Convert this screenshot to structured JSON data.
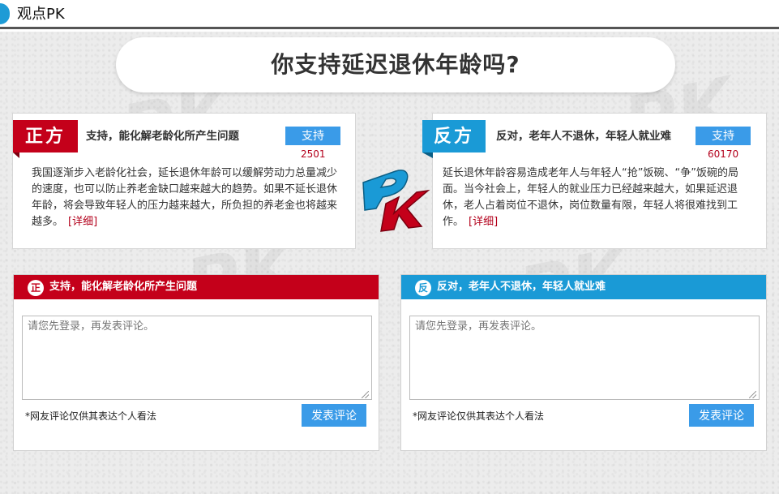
{
  "header": {
    "title": "观点PK"
  },
  "question": "你支持延迟退休年龄吗?",
  "pro": {
    "tag": "正方",
    "title": "支持，能化解老龄化所产生问题",
    "vote_label": "支持",
    "vote_count": "2501",
    "body": "我国逐渐步入老龄化社会，延长退休年龄可以缓解劳动力总量减少的速度，也可以防止养老金缺口越来越大的趋势。如果不延长退休年龄，将会导致年轻人的压力越来越大，所负担的养老金也将越来越多。",
    "detail_label": "[详细]"
  },
  "con": {
    "tag": "反方",
    "title": "反对，老年人不退休，年轻人就业难",
    "vote_label": "支持",
    "vote_count": "60170",
    "body": "延长退休年龄容易造成老年人与年轻人“抢”饭碗、“争”饭碗的局面。当今社会上，年轻人的就业压力已经越来越大，如果延迟退休，老人占着岗位不退休，岗位数量有限，年轻人将很难找到工作。",
    "detail_label": "[详细]"
  },
  "pro_panel": {
    "badge": "正",
    "heading": "支持，能化解老龄化所产生问题",
    "comment_placeholder": "请您先登录，再发表评论。",
    "disclaimer": "*网友评论仅供其表达个人看法",
    "submit_label": "发表评论"
  },
  "con_panel": {
    "badge": "反",
    "heading": "反对，老年人不退休，年轻人就业难",
    "comment_placeholder": "请您先登录，再发表评论。",
    "disclaimer": "*网友评论仅供其表达个人看法",
    "submit_label": "发表评论"
  },
  "logo": {
    "text": "PK",
    "colors": {
      "p": "#1a9ad6",
      "k": "#c4001a"
    }
  },
  "colors": {
    "pro": "#c4001a",
    "con": "#1a9ad6",
    "button": "#3a9be8"
  }
}
